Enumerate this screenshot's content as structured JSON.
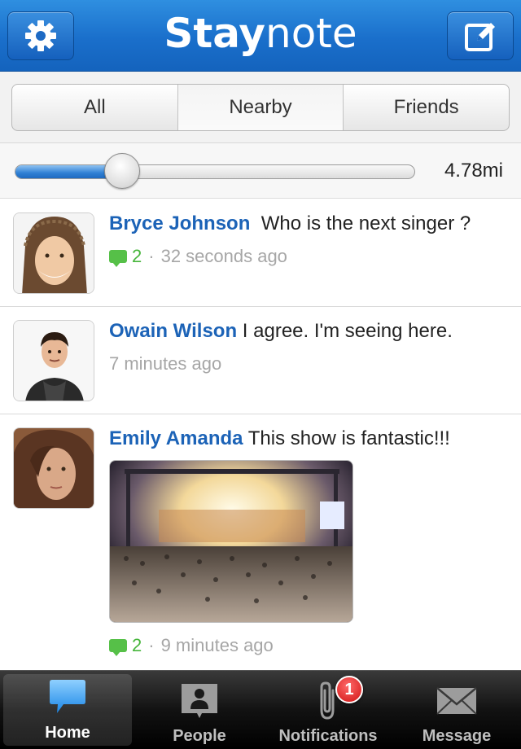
{
  "header": {
    "logo_bold": "Stay",
    "logo_light": "note",
    "settings_icon": "gear-icon",
    "compose_icon": "compose-icon"
  },
  "filter": {
    "tabs": [
      {
        "label": "All"
      },
      {
        "label": "Nearby"
      },
      {
        "label": "Friends"
      }
    ],
    "selected": "Nearby"
  },
  "distance": {
    "value_label": "4.78mi",
    "slider_fraction": 0.26
  },
  "posts": [
    {
      "name": "Bryce Johnson",
      "text": "Who is the next singer ?",
      "comments": "2",
      "time": "32 seconds ago"
    },
    {
      "name": "Owain Wilson",
      "text": "I agree. I'm seeing here.",
      "time": "7 minutes ago"
    },
    {
      "name": "Emily Amanda",
      "text": "This show is fantastic!!!",
      "comments": "2",
      "time": "9 minutes ago"
    }
  ],
  "tabbar": {
    "items": [
      {
        "label": "Home",
        "icon": "chat-bubble-icon"
      },
      {
        "label": "People",
        "icon": "person-card-icon"
      },
      {
        "label": "Notifications",
        "icon": "paperclip-icon",
        "badge": "1"
      },
      {
        "label": "Message",
        "icon": "envelope-icon"
      }
    ],
    "active": "Home"
  },
  "colors": {
    "header_blue": "#1a6fcb",
    "name_blue": "#1c63b7",
    "comment_green": "#46b53b",
    "badge_red": "#d01212"
  }
}
